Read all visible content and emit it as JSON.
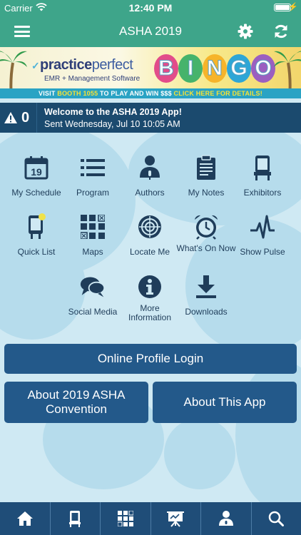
{
  "status_bar": {
    "carrier": "Carrier",
    "time": "12:40 PM"
  },
  "nav": {
    "title": "ASHA 2019",
    "left_icon": "hamburger-menu-icon",
    "right_icons": [
      "gear-icon",
      "refresh-icon"
    ]
  },
  "banner": {
    "brand_bold": "practice",
    "brand_light": "perfect",
    "brand_sub": "EMR + Management Software",
    "bingo_letters": [
      "B",
      "I",
      "N",
      "G",
      "O"
    ],
    "bingo_colors": [
      "#e24c8a",
      "#46b36b",
      "#f6b42a",
      "#2ea6d6",
      "#9b5fc0"
    ],
    "ribbon_pre": "VISIT ",
    "ribbon_booth": "BOOTH 1055",
    "ribbon_mid": " TO PLAY AND WIN $$$ ",
    "ribbon_link": "CLICK HERE FOR DETAILS!"
  },
  "notice": {
    "count": "0",
    "message": "Welcome to the ASHA 2019 App!",
    "sent": "Sent Wednesday, Jul 10 10:05 AM"
  },
  "grid": {
    "items": [
      {
        "label": "My Schedule",
        "icon": "calendar-icon"
      },
      {
        "label": "Program",
        "icon": "list-icon"
      },
      {
        "label": "Authors",
        "icon": "speaker-icon"
      },
      {
        "label": "My Notes",
        "icon": "clipboard-icon"
      },
      {
        "label": "Exhibitors",
        "icon": "booth-icon"
      },
      {
        "label": "Quick List",
        "icon": "quick-list-icon"
      },
      {
        "label": "Maps",
        "icon": "map-grid-icon"
      },
      {
        "label": "Locate Me",
        "icon": "crosshair-icon"
      },
      {
        "label": "What's On Now",
        "icon": "alarm-clock-icon"
      },
      {
        "label": "Show Pulse",
        "icon": "pulse-icon"
      },
      {
        "label": "Social Media",
        "icon": "chat-bubbles-icon"
      },
      {
        "label": "More Information",
        "icon": "info-icon"
      },
      {
        "label": "Downloads",
        "icon": "download-icon"
      }
    ]
  },
  "buttons": {
    "profile_login": "Online Profile Login",
    "about_convention": "About 2019 ASHA Convention",
    "about_app": "About This App"
  },
  "tabbar": {
    "tabs": [
      "home-icon",
      "phone-icon",
      "grid-icon",
      "presentation-icon",
      "speaker-icon",
      "search-icon"
    ]
  },
  "colors": {
    "header": "#3ea58a",
    "button": "#23598a",
    "tabbar": "#1f4d78",
    "notice": "#1b4a6e",
    "icon": "#1f3d5a"
  }
}
